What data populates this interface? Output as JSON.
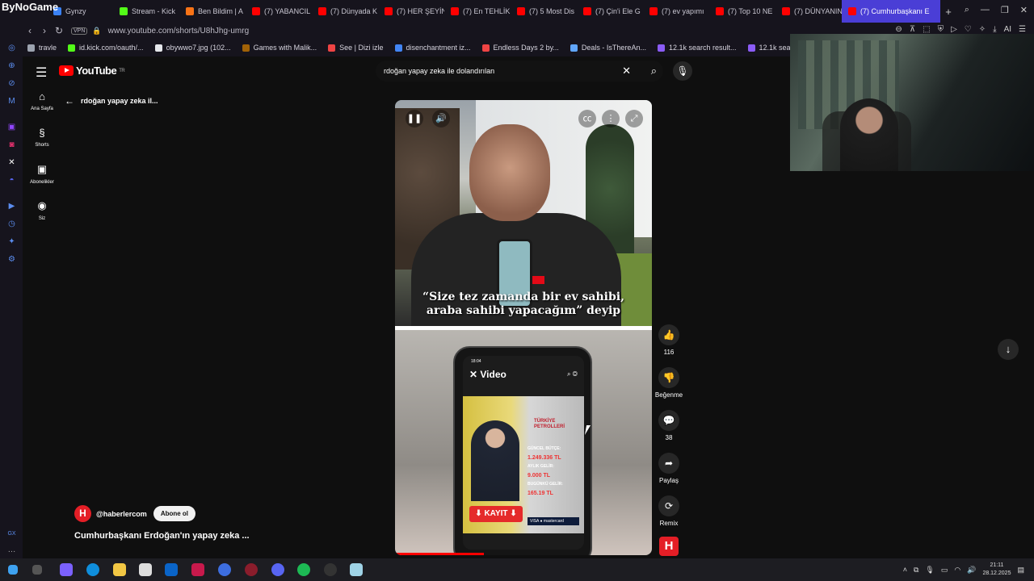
{
  "stream_logo": "ByNoGame",
  "tabs": [
    {
      "label": "Gynzy",
      "color": "#3b82f6"
    },
    {
      "label": "Stream - Kick",
      "color": "#53fc18"
    },
    {
      "label": "Ben Bildim | A",
      "color": "#f97316"
    },
    {
      "label": "(7) YABANCIL",
      "color": "#ff0000"
    },
    {
      "label": "(7) Dünyada K",
      "color": "#ff0000"
    },
    {
      "label": "(7) HER ŞEYİN",
      "color": "#ff0000"
    },
    {
      "label": "(7) En TEHLİK",
      "color": "#ff0000"
    },
    {
      "label": "(7) 5 Most Dis",
      "color": "#ff0000"
    },
    {
      "label": "(7) Çin'i Ele G",
      "color": "#ff0000"
    },
    {
      "label": "(7) ev yapımı",
      "color": "#ff0000"
    },
    {
      "label": "(7) Top 10 NE",
      "color": "#ff0000"
    },
    {
      "label": "(7) DÜNYANIN",
      "color": "#ff0000"
    },
    {
      "label": "(7) Cumhurbaşkanı E",
      "color": "#ff0000",
      "active": true
    }
  ],
  "address": {
    "vpn": "VPN",
    "url": "www.youtube.com/shorts/U8hJhg-umrg"
  },
  "bookmarks": [
    {
      "label": "travle",
      "color": "#9ca3af"
    },
    {
      "label": "id.kick.com/oauth/...",
      "color": "#53fc18"
    },
    {
      "label": "obywwo7.jpg (102...",
      "color": "#e5e7eb"
    },
    {
      "label": "Games with Malik...",
      "color": "#a16207"
    },
    {
      "label": "See | Dizi izle",
      "color": "#ef4444"
    },
    {
      "label": "disenchantment iz...",
      "color": "#4285f4"
    },
    {
      "label": "Endless Days 2 by...",
      "color": "#ef4444"
    },
    {
      "label": "Deals - IsThereAn...",
      "color": "#60a5fa"
    },
    {
      "label": "12.1k search result...",
      "color": "#8b5cf6"
    },
    {
      "label": "12.1k search result...",
      "color": "#8b5cf6"
    }
  ],
  "youtube": {
    "logo_text": "YouTube",
    "logo_sup": "TR",
    "search_value": "rdoğan yapay zeka ile dolandırılan",
    "guide": [
      {
        "icon": "⌂",
        "label": "Ana Sayfa"
      },
      {
        "icon": "§",
        "label": "Shorts"
      },
      {
        "icon": "▣",
        "label": "Abonelikler"
      },
      {
        "icon": "◉",
        "label": "Siz"
      }
    ],
    "back_title": "rdoğan yapay zeka il...",
    "caption_line1": "“Size tez zamanda bir ev sahibi,",
    "caption_line2": "araba sahibi yapacağım” deyip",
    "phone": {
      "time": "18:04",
      "header": "✕ Video",
      "tp_logo": "TÜRKİYE PETROLLERİ",
      "budget_label": "GÜNCEL BÜTÇE:",
      "budget_value": "1.249.336 TL",
      "monthly_label": "AYLIK GELİR:",
      "monthly_value": "9.000 TL",
      "daily_label": "BUGÜNKÜ GELİR:",
      "daily_value": "165.19 TL",
      "kayit": "⬇ KAYIT ⬇",
      "visa": "VISA ● mastercard"
    },
    "actions": [
      {
        "icon": "👍",
        "label": "116",
        "name": "like"
      },
      {
        "icon": "👎",
        "label": "Beğenme",
        "name": "dislike"
      },
      {
        "icon": "💬",
        "label": "38",
        "name": "comments"
      },
      {
        "icon": "➦",
        "label": "Paylaş",
        "name": "share"
      },
      {
        "icon": "⟳",
        "label": "Remix",
        "name": "remix"
      }
    ],
    "channel": "@haberlercom",
    "channel_initial": "H",
    "subscribe": "Abone ol",
    "video_title": "Cumhurbaşkanı Erdoğan'ın yapay zeka ..."
  },
  "taskbar": {
    "time": "21:11",
    "date": "28.12.2025"
  }
}
